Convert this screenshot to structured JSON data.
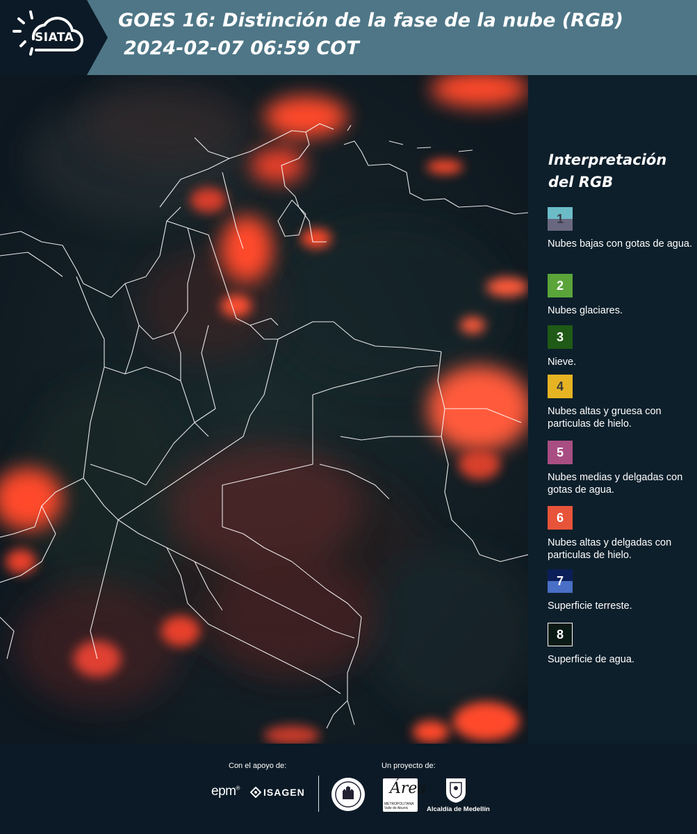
{
  "header": {
    "logo_text": "SIATA",
    "title_line1": "GOES 16: Distinción de la fase de la nube (RGB)",
    "title_line2": "2024-02-07 06:59 COT",
    "background_color": "#4e7686",
    "logo_background_color": "#0b1a26"
  },
  "map": {
    "description_colors": {
      "background": "#121c24",
      "cloud": "#ff4a2a",
      "borders": "#ffffff"
    }
  },
  "legend": {
    "title": "Interpretación\ndel RGB",
    "items": [
      {
        "number": "1",
        "label": "Nubes bajas con gotas de agua.",
        "color_top": "#6cbcc8",
        "color_bottom": "#6a6880",
        "number_color": "#3a3a48"
      },
      {
        "number": "2",
        "label": "Nubes glaciares.",
        "color_top": "#5aa43a",
        "color_bottom": "#5aa43a",
        "number_color": "#ffffff"
      },
      {
        "number": "3",
        "label": "Nieve.",
        "color_top": "#1f5a16",
        "color_bottom": "#1f5a16",
        "number_color": "#ffffff"
      },
      {
        "number": "4",
        "label": "Nubes altas y gruesa con particulas de hielo.",
        "color_top": "#e6b323",
        "color_bottom": "#e6b323",
        "number_color": "#3a3a3a"
      },
      {
        "number": "5",
        "label": "Nubes medias y delgadas con gotas de agua.",
        "color_top": "#a84e82",
        "color_bottom": "#a84e82",
        "number_color": "#ffffff"
      },
      {
        "number": "6",
        "label": "Nubes altas y delgadas con particulas de hielo.",
        "color_top": "#e8543a",
        "color_bottom": "#e8543a",
        "number_color": "#ffffff"
      },
      {
        "number": "7",
        "label": "Superficie terreste.",
        "color_top": "#0b1e58",
        "color_bottom": "#4a6fc6",
        "number_color": "#ffffff"
      },
      {
        "number": "8",
        "label": "Superficie de agua.",
        "color_top": "#0a1a14",
        "color_bottom": "#0a1a14",
        "number_color": "#ffffff",
        "border": "#ffffff"
      }
    ]
  },
  "footer": {
    "support_label": "Con el apoyo de:",
    "project_label": "Un proyecto de:",
    "epm": "epm",
    "epm_mark": "®",
    "isagen": "ISAGEN",
    "area_letter": "Área",
    "area_sub1": "METROPOLITANA",
    "area_sub2": "Valle de Aburrá",
    "alcaldia": "Alcaldía de Medellín"
  }
}
